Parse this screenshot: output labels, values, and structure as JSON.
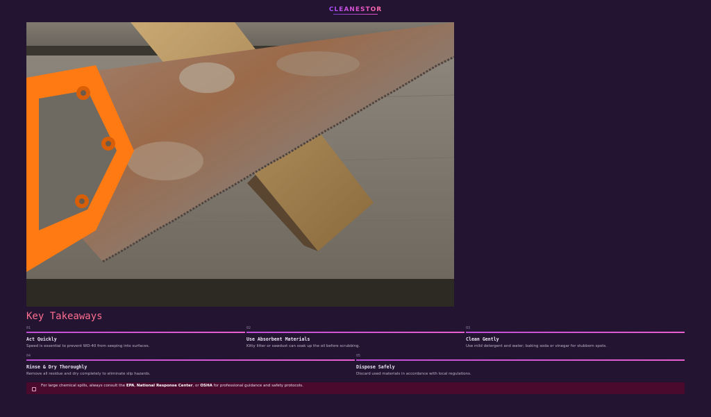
{
  "brand": {
    "logo_text": "CLEANESTOR"
  },
  "hero": {
    "image": "rusty hand saw with orange handle resting on a wooden plank"
  },
  "section": {
    "title": "Key Takeaways"
  },
  "takeaways": [
    {
      "num": "01",
      "title": "Act Quickly",
      "desc": "Speed is essential to prevent WD-40 from seeping into surfaces."
    },
    {
      "num": "02",
      "title": "Use Absorbent Materials",
      "desc": "Kitty litter or sawdust can soak up the oil before scrubbing."
    },
    {
      "num": "03",
      "title": "Clean Gently",
      "desc": "Use mild detergent and water; baking soda or vinegar for stubborn spots."
    },
    {
      "num": "04",
      "title": "Rinse & Dry Thoroughly",
      "desc": "Remove all residue and dry completely to eliminate slip hazards."
    },
    {
      "num": "05",
      "title": "Dispose Safely",
      "desc": "Discard used materials in accordance with local regulations."
    }
  ],
  "notice": {
    "prefix": "For large chemical spills, always consult the ",
    "org1": "EPA",
    "sep1": ", ",
    "org2": "National Response Center",
    "sep2": ", or ",
    "org3": "OSHA",
    "suffix": " for professional guidance and safety protocols."
  },
  "colors": {
    "background": "#231432",
    "accent_title": "#ff6f8f",
    "accent_bar": "#c04fd8",
    "notice_bg": "#4a0a2e"
  }
}
